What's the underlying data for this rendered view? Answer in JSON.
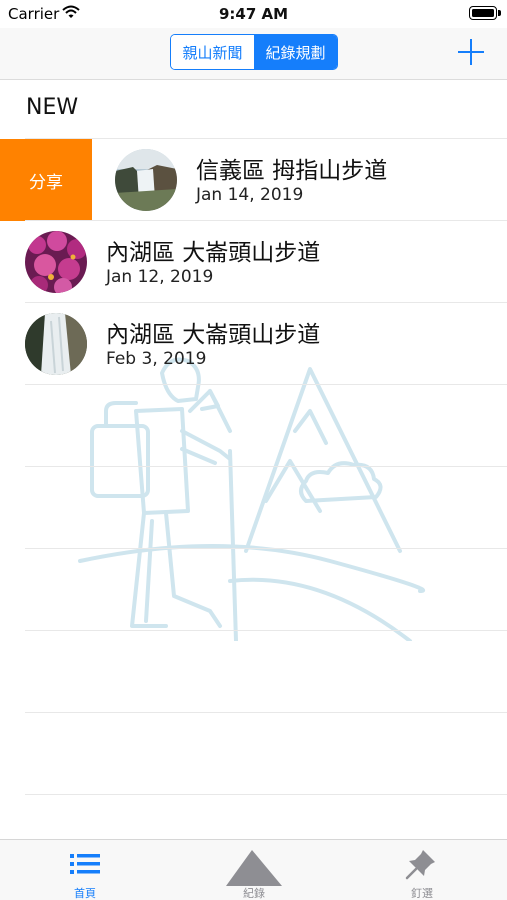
{
  "status_bar": {
    "carrier": "Carrier",
    "time": "9:47 AM"
  },
  "nav": {
    "segments": [
      {
        "label": "親山新聞",
        "selected": false
      },
      {
        "label": "紀錄規劃",
        "selected": true
      }
    ],
    "add_icon": "plus-icon",
    "accent_color": "#157efb"
  },
  "list": {
    "section_header": "NEW",
    "swipe_action_label": "分享",
    "swipe_action_color": "#ff8200",
    "items": [
      {
        "title": "信義區 拇指山步道",
        "date": "Jan 14, 2019",
        "thumbnail": "waterfall-cliff-photo"
      },
      {
        "title": "內湖區 大崙頭山步道",
        "date": "Jan 12, 2019",
        "thumbnail": "pink-flowers-photo"
      },
      {
        "title": "內湖區 大崙頭山步道",
        "date": "Feb 3, 2019",
        "thumbnail": "waterfall-stream-photo"
      }
    ]
  },
  "tab_bar": {
    "tabs": [
      {
        "label": "首頁",
        "icon": "list-icon",
        "active": true
      },
      {
        "label": "紀錄",
        "icon": "mountain-icon",
        "active": false
      },
      {
        "label": "釘選",
        "icon": "pushpin-icon",
        "active": false
      }
    ]
  }
}
